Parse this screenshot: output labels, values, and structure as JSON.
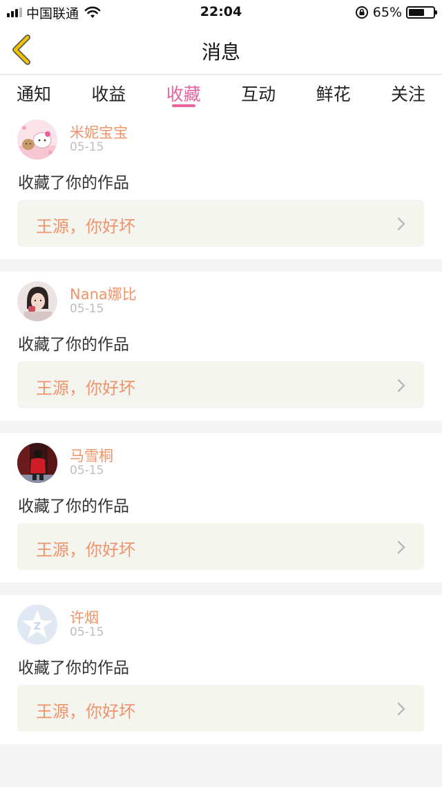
{
  "status_bar": {
    "carrier": "中国联通",
    "time": "22:04",
    "battery_percent": "65%",
    "battery_level": 0.65
  },
  "header": {
    "title": "消息",
    "back_icon": "chevron-left-icon"
  },
  "tabs": [
    {
      "label": "通知"
    },
    {
      "label": "收益"
    },
    {
      "label": "收藏",
      "active": true
    },
    {
      "label": "互动"
    },
    {
      "label": "鲜花"
    },
    {
      "label": "关注"
    }
  ],
  "colors": {
    "accent_pink": "#e8639c",
    "username_orange": "#f0936a",
    "back_yellow": "#f3c300"
  },
  "feed": [
    {
      "username": "米妮宝宝",
      "date": "05-15",
      "action": "收藏了你的作品",
      "work_title": "王源，你好坏",
      "avatar_icon": "hello-kitty-avatar"
    },
    {
      "username": "Nana娜比",
      "date": "05-15",
      "action": "收藏了你的作品",
      "work_title": "王源，你好坏",
      "avatar_icon": "girl-photo-avatar"
    },
    {
      "username": "马雪桐",
      "date": "05-15",
      "action": "收藏了你的作品",
      "work_title": "王源，你好坏",
      "avatar_icon": "red-jacket-photo-avatar"
    },
    {
      "username": "许烟",
      "date": "05-15",
      "action": "收藏了你的作品",
      "work_title": "王源，你好坏",
      "avatar_icon": "qq-default-avatar"
    }
  ]
}
